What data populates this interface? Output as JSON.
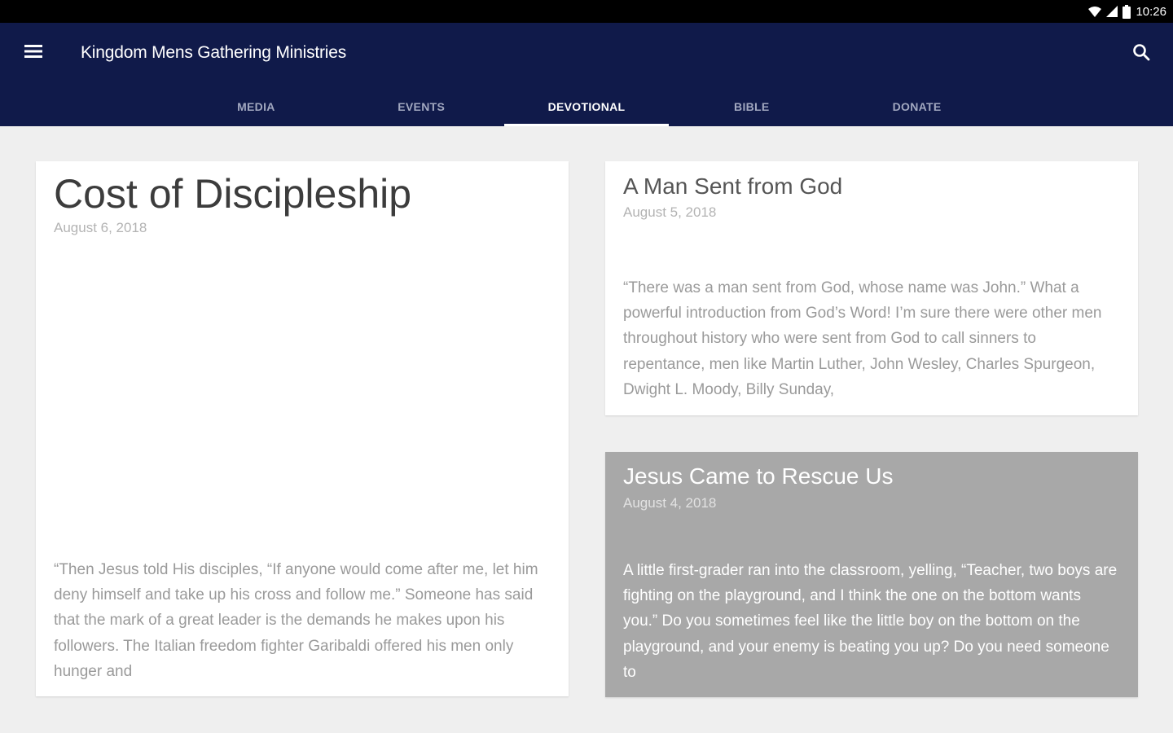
{
  "status_bar": {
    "time": "10:26",
    "icons": [
      "wifi-icon",
      "signal-icon",
      "battery-icon"
    ]
  },
  "app_bar": {
    "title": "Kingdom Mens Gathering Ministries",
    "background_color": "#101a4a",
    "menu_icon": "menu-icon",
    "search_icon": "search-icon"
  },
  "tabs": [
    {
      "label": "MEDIA",
      "active": false
    },
    {
      "label": "EVENTS",
      "active": false
    },
    {
      "label": "DEVOTIONAL",
      "active": true
    },
    {
      "label": "BIBLE",
      "active": false
    },
    {
      "label": "DONATE",
      "active": false
    }
  ],
  "devotionals": [
    {
      "title": "Cost of Discipleship",
      "date": "August 6, 2018",
      "excerpt": "“Then Jesus told His disciples, “If anyone would come after me, let him deny himself and take up his cross and follow me.” Someone has said that the mark of a great leader is the demands he makes upon his followers. The Italian freedom fighter Garibaldi offered his men only hunger and"
    },
    {
      "title": "A Man Sent from God",
      "date": "August 5, 2018",
      "excerpt": "“There was a man sent from God, whose name was John.” What a powerful introduction from God’s Word! I’m sure there were other men throughout history who were sent from God to call sinners to repentance, men like Martin Luther, John Wesley, Charles Spurgeon, Dwight L. Moody, Billy Sunday,"
    },
    {
      "title": "Jesus Came to Rescue Us",
      "date": "August 4, 2018",
      "excerpt": "A little first-grader ran into the classroom, yelling, “Teacher, two boys are fighting on the playground, and I think the one on the bottom wants you.” Do you sometimes feel like the little boy on the bottom on the playground, and your enemy is beating you up? Do you need someone to"
    }
  ]
}
